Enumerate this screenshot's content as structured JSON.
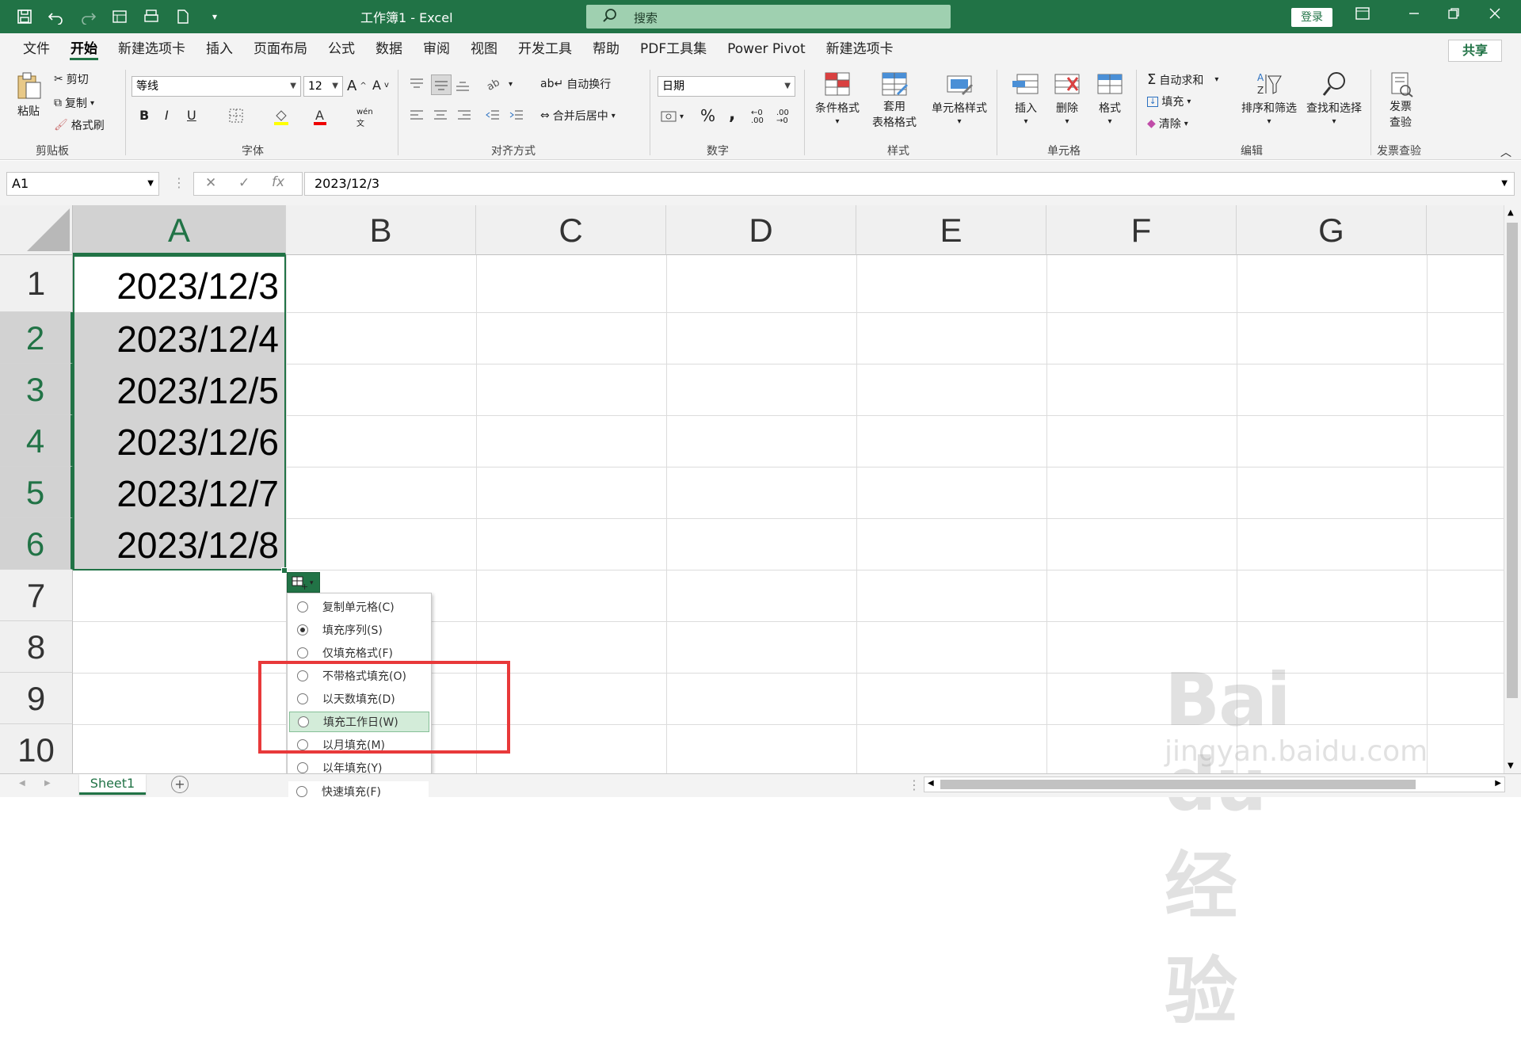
{
  "titlebar": {
    "title": "工作簿1 - Excel",
    "search_placeholder": "搜索",
    "login": "登录"
  },
  "tabs": [
    "文件",
    "开始",
    "新建选项卡",
    "插入",
    "页面布局",
    "公式",
    "数据",
    "审阅",
    "视图",
    "开发工具",
    "帮助",
    "PDF工具集",
    "Power Pivot",
    "新建选项卡"
  ],
  "active_tab": "开始",
  "share": "共享",
  "ribbon": {
    "clipboard": {
      "paste": "粘贴",
      "cut": "剪切",
      "copy": "复制",
      "format_painter": "格式刷",
      "label": "剪贴板"
    },
    "font": {
      "name": "等线",
      "size": "12",
      "bold": "B",
      "italic": "I",
      "underline": "U",
      "label": "字体"
    },
    "align": {
      "wrap": "自动换行",
      "merge": "合并后居中",
      "label": "对齐方式"
    },
    "number": {
      "format": "日期",
      "percent": "%",
      "comma": ",",
      "label": "数字"
    },
    "styles": {
      "conditional": "条件格式",
      "table_format_1": "套用",
      "table_format_2": "表格格式",
      "cell_styles": "单元格样式",
      "label": "样式"
    },
    "cells": {
      "insert": "插入",
      "delete": "删除",
      "format": "格式",
      "label": "单元格"
    },
    "editing": {
      "autosum": "自动求和",
      "fill": "填充",
      "clear": "清除",
      "sort": "排序和筛选",
      "find": "查找和选择",
      "label": "编辑"
    },
    "invoice": {
      "check_1": "发票",
      "check_2": "查验",
      "label": "发票查验"
    }
  },
  "formula_bar": {
    "name_box": "A1",
    "fx": "fx",
    "formula": "2023/12/3"
  },
  "columns": [
    "A",
    "B",
    "C",
    "D",
    "E",
    "F",
    "G"
  ],
  "rows": [
    "1",
    "2",
    "3",
    "4",
    "5",
    "6",
    "7",
    "8",
    "9",
    "10"
  ],
  "cells_a": [
    "2023/12/3",
    "2023/12/4",
    "2023/12/5",
    "2023/12/6",
    "2023/12/7",
    "2023/12/8"
  ],
  "autofill_menu": [
    {
      "label": "复制单元格(C)",
      "selected": false
    },
    {
      "label": "填充序列(S)",
      "selected": true
    },
    {
      "label": "仅填充格式(F)",
      "selected": false
    },
    {
      "label": "不带格式填充(O)",
      "selected": false
    },
    {
      "label": "以天数填充(D)",
      "selected": false
    },
    {
      "label": "填充工作日(W)",
      "selected": false
    },
    {
      "label": "以月填充(M)",
      "selected": false
    },
    {
      "label": "以年填充(Y)",
      "selected": false
    },
    {
      "label": "快速填充(F)",
      "selected": false
    }
  ],
  "sheet_tab": "Sheet1",
  "watermark": {
    "brand": "Bai du 经验",
    "url": "jingyan.baidu.com"
  },
  "colors": {
    "accent": "#217346",
    "highlight": "#e8393a"
  }
}
